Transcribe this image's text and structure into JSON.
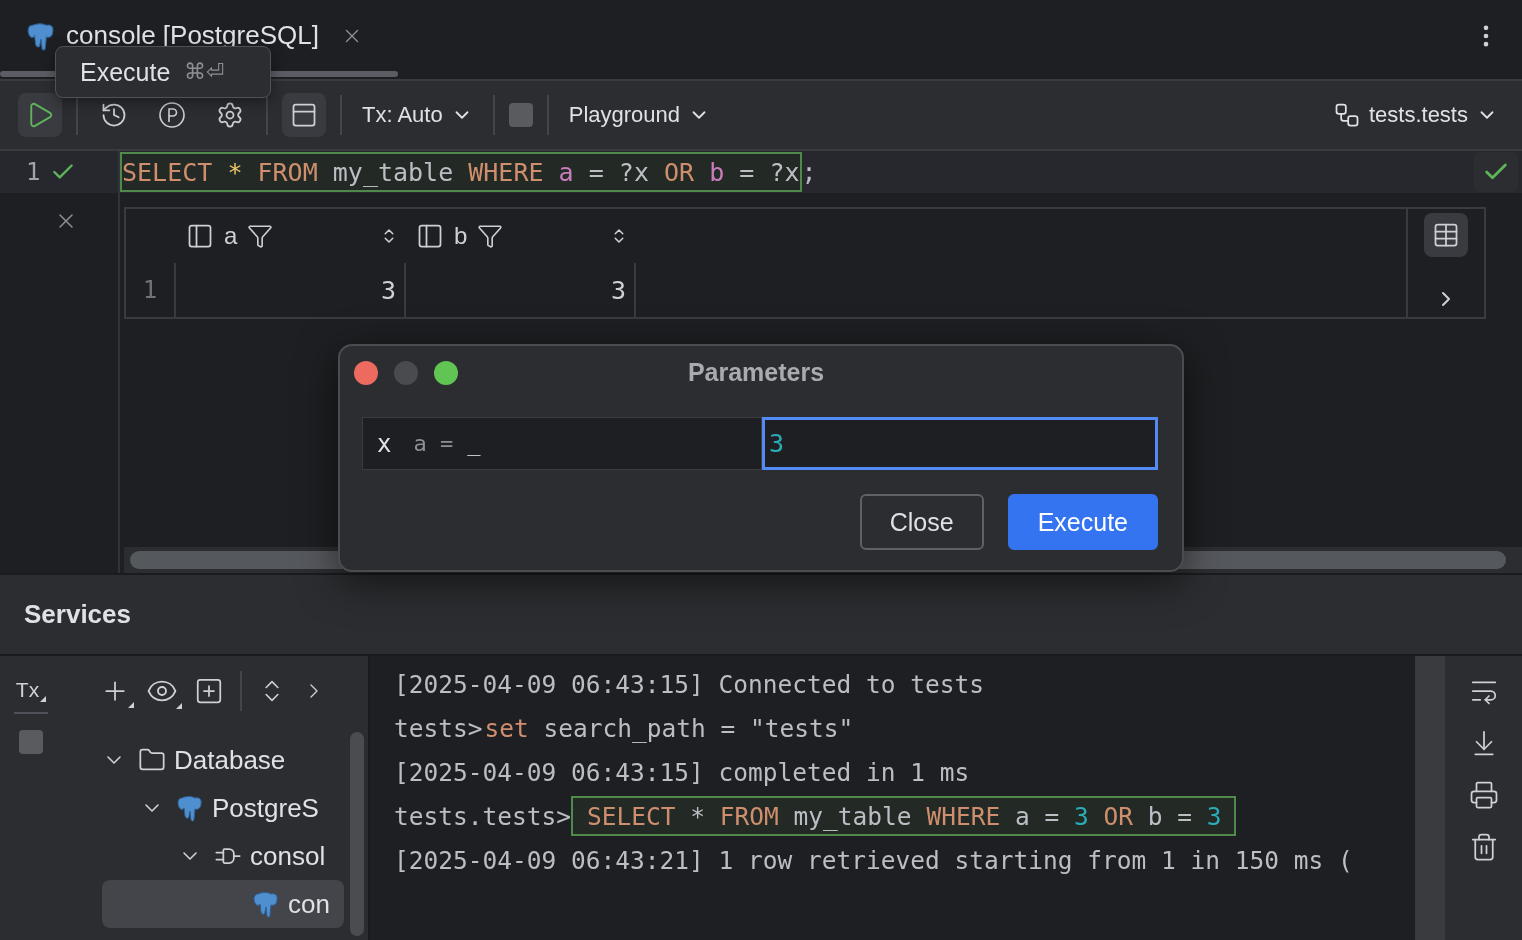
{
  "tab": {
    "title": "console [PostgreSQL]"
  },
  "tooltip": {
    "label": "Execute",
    "shortcut": "⌘⏎"
  },
  "toolbar": {
    "tx_mode": "Tx: Auto",
    "session": "Playground",
    "schema": "tests.tests"
  },
  "editor": {
    "line_number": "1",
    "valid": true,
    "terminator": ";",
    "tokens": [
      {
        "kind": "keyword",
        "text": "SELECT"
      },
      {
        "kind": "star",
        "text": "*"
      },
      {
        "kind": "keyword",
        "text": "FROM"
      },
      {
        "kind": "plain",
        "text": "my_table"
      },
      {
        "kind": "keyword",
        "text": "WHERE"
      },
      {
        "kind": "ident",
        "text": "a"
      },
      {
        "kind": "plain",
        "text": "="
      },
      {
        "kind": "plain",
        "text": "?x"
      },
      {
        "kind": "keyword",
        "text": "OR"
      },
      {
        "kind": "ident",
        "text": "b"
      },
      {
        "kind": "plain",
        "text": "="
      },
      {
        "kind": "plain",
        "text": "?x"
      }
    ]
  },
  "result": {
    "columns": [
      {
        "name": "a"
      },
      {
        "name": "b"
      }
    ],
    "rows": [
      {
        "number": "1",
        "cells": [
          "3",
          "3"
        ]
      }
    ]
  },
  "dialog": {
    "title": "Parameters",
    "param": {
      "name": "x",
      "context": "a =",
      "placeholder_mark": "_"
    },
    "input": {
      "value": "3",
      "focused": true
    },
    "buttons": [
      {
        "label": "Close",
        "kind": "secondary"
      },
      {
        "label": "Execute",
        "kind": "primary"
      }
    ]
  },
  "services": {
    "title": "Services",
    "tx_label": "Tx",
    "tree": [
      {
        "label": "Database",
        "kind": "group",
        "expanded": true,
        "selected": false,
        "children": [
          {
            "label": "PostgreS",
            "kind": "datasource",
            "expanded": true,
            "selected": false,
            "children": [
              {
                "label": "consol",
                "kind": "session",
                "expanded": true,
                "selected": false,
                "children": [
                  {
                    "label": "con",
                    "kind": "console",
                    "selected": true
                  }
                ]
              }
            ]
          }
        ]
      }
    ],
    "console": [
      {
        "kind": "log",
        "text": "[2025-04-09 06:43:15] Connected to tests"
      },
      {
        "kind": "command",
        "prompt": "tests>",
        "highlighted": false,
        "tokens": [
          {
            "kind": "keyword",
            "text": "set"
          },
          {
            "kind": "plain",
            "text": "search_path"
          },
          {
            "kind": "plain",
            "text": "="
          },
          {
            "kind": "plain",
            "text": "\"tests\""
          }
        ]
      },
      {
        "kind": "log",
        "text": "[2025-04-09 06:43:15] completed in 1 ms"
      },
      {
        "kind": "command",
        "prompt": "tests.tests>",
        "highlighted": true,
        "tokens": [
          {
            "kind": "keyword",
            "text": "SELECT"
          },
          {
            "kind": "plain",
            "text": "*"
          },
          {
            "kind": "keyword",
            "text": "FROM"
          },
          {
            "kind": "plain",
            "text": "my_table"
          },
          {
            "kind": "keyword",
            "text": "WHERE"
          },
          {
            "kind": "plain",
            "text": "a"
          },
          {
            "kind": "plain",
            "text": "="
          },
          {
            "kind": "number",
            "text": "3"
          },
          {
            "kind": "keyword",
            "text": "OR"
          },
          {
            "kind": "plain",
            "text": "b"
          },
          {
            "kind": "plain",
            "text": "="
          },
          {
            "kind": "number",
            "text": "3"
          }
        ]
      },
      {
        "kind": "log",
        "text": "[2025-04-09 06:43:21] 1 row retrieved starting from 1 in 150 ms ("
      }
    ]
  }
}
